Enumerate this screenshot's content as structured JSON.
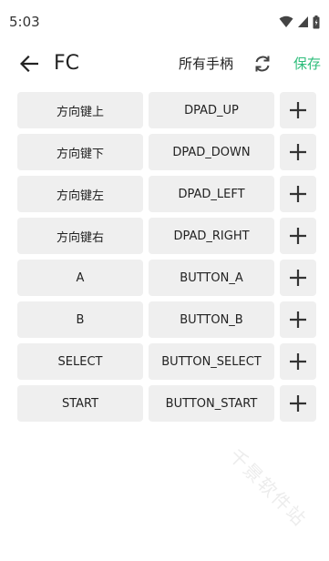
{
  "status_bar": {
    "time": "5:03",
    "icons": [
      "wifi-icon",
      "signal-icon",
      "battery-icon"
    ]
  },
  "app_bar": {
    "back_icon": "back-arrow-icon",
    "title": "FC",
    "controller_selector": "所有手柄",
    "refresh_icon": "refresh-icon",
    "save_label": "保存"
  },
  "colors": {
    "accent": "#2ebd7b",
    "cell_background": "#efefef"
  },
  "mappings": [
    {
      "name": "方向键上",
      "key": "DPAD_UP"
    },
    {
      "name": "方向键下",
      "key": "DPAD_DOWN"
    },
    {
      "name": "方向键左",
      "key": "DPAD_LEFT"
    },
    {
      "name": "方向键右",
      "key": "DPAD_RIGHT"
    },
    {
      "name": "A",
      "key": "BUTTON_A"
    },
    {
      "name": "B",
      "key": "BUTTON_B"
    },
    {
      "name": "SELECT",
      "key": "BUTTON_SELECT"
    },
    {
      "name": "START",
      "key": "BUTTON_START"
    }
  ],
  "add_icon": "plus-icon",
  "watermark": "千景软件站"
}
